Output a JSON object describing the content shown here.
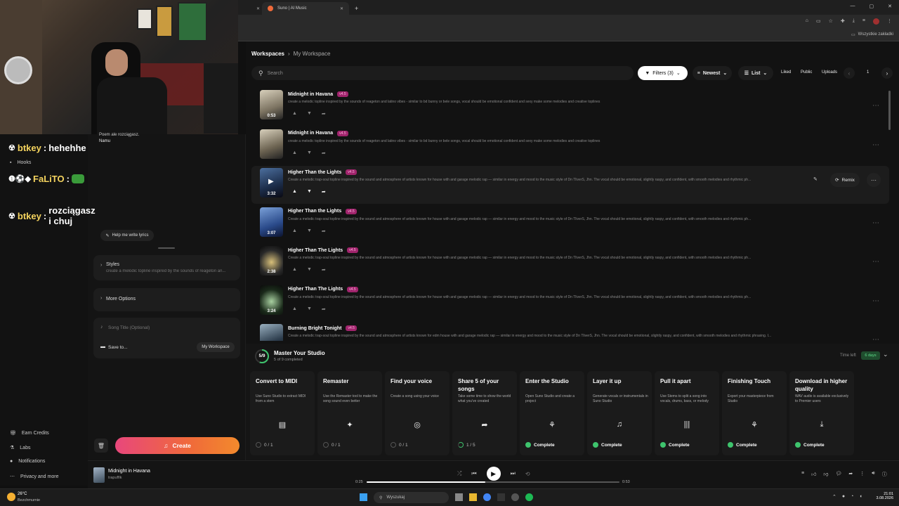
{
  "browser": {
    "tab_title": "Suno | AI Music",
    "bookmarks_label": "Wszystkie zakładki"
  },
  "chat_overlay": {
    "messages": [
      {
        "user": "btkey",
        "text": "hehehhe"
      },
      {
        "user": "FaLiTO",
        "text": ""
      },
      {
        "user": "btkey",
        "text": "rozciągasz i chuj"
      }
    ]
  },
  "create_panel": {
    "lyrics_partial": "Poem ale rozciągasz.",
    "lyrics_typed": "Namu",
    "hooks_label": "Hooks",
    "help_lyrics_label": "Help me write lyrics",
    "styles_label": "Styles",
    "styles_value": "create a melodic topline inspired by the sounds of reageton an...",
    "more_options_label": "More Options",
    "song_title_placeholder": "Song Title (Optional)",
    "save_to_label": "Save to...",
    "workspace_label": "My Workspace",
    "create_label": "Create"
  },
  "left_nav": {
    "items": [
      {
        "label": "Earn Credits",
        "icon": "gift-icon"
      },
      {
        "label": "Labs",
        "icon": "flask-icon"
      },
      {
        "label": "Notifications",
        "icon": "bell-icon"
      },
      {
        "label": "Privacy and more",
        "icon": "dots-icon"
      }
    ]
  },
  "breadcrumb": {
    "root": "Workspaces",
    "current": "My Workspace"
  },
  "toolbar": {
    "search_placeholder": "Search",
    "filters_label": "Filters (3)",
    "sort_label": "Newest",
    "view_label": "List",
    "liked": "Liked",
    "public": "Public",
    "uploads": "Uploads",
    "page": "1"
  },
  "songs": [
    {
      "title": "Midnight in Havana",
      "version": "v4.5",
      "duration": "0:53",
      "desc": "create a melodic topline inspired by the sounds of reageton and latino vibes - similar to bd bunny or bele songs, vocal should be emotional confident and sexy make some melodies and creative toplines"
    },
    {
      "title": "Midnight in Havana",
      "version": "v4.5",
      "duration": "",
      "desc": "create a melodic topline inspired by the sounds of reageton and latino vibes - similar to bd bunny or bele songs, vocal should be emotional confident and sexy make some melodies and creative toplines"
    },
    {
      "title": "Higher Than the Lights",
      "version": "v4.5",
      "duration": "3:32",
      "desc": "Create a melodic trap-soul topline inspired by the sound and atmosphere of artists known for house with and garage melodic rap — similar in energy and mood to the music style of Dn TliverS, Jhn. The vocal should be emotional, slightly raspy, and confident, with smooth melodies and rhythmic ph..."
    },
    {
      "title": "Higher Than the Lights",
      "version": "v4.5",
      "duration": "3:07",
      "desc": "Create a melodic trap-soul topline inspired by the sound and atmosphere of artists known for house with and garage melodic rap — similar in energy and mood to the music style of Dn TliverS, Jhn. The vocal should be emotional, slightly raspy, and confident, with smooth melodies and rhythmic ph..."
    },
    {
      "title": "Higher Than The Lights",
      "version": "v4.5",
      "duration": "2:38",
      "desc": "Create a melodic trap-soul topline inspired by the sound and atmosphere of artists known for house with and garage melodic rap — similar in energy and mood to the music style of Dn TliverS, Jhn. The vocal should be emotional, slightly raspy, and confident, with smooth melodies and rhythmic ph..."
    },
    {
      "title": "Higher Than The Lights",
      "version": "v4.5",
      "duration": "3:24",
      "desc": "Create a melodic trap-soul topline inspired by the sound and atmosphere of artists known for house with and garage melodic rap — similar in energy and mood to the music style of Dn TliverS, Jhn. The vocal should be emotional, slightly raspy, and confident, with smooth melodies and rhythmic ph..."
    },
    {
      "title": "Burning Bright Tonight",
      "version": "v4.5",
      "duration": "",
      "desc": "Create a melodic trap-soul topline inspired by the sound and atmosphere of artists known for edm house with and garage melodic rap — similar in energy and mood to the music style of Dn TliverS, Jhn. The vocal should be emotional, slightly raspy, and confident, with smooth melodies and rhythmic phrasing. I..."
    }
  ],
  "remix_label": "Remix",
  "studio": {
    "progress": "5/9",
    "progress_fraction": 0.5556,
    "title": "Master Your Studio",
    "subtitle": "5 of 9 completed",
    "time_left_label": "Time left",
    "time_left_value": "6 days",
    "tasks": [
      {
        "title": "Convert to MIDI",
        "desc": "Use Suno Studio to extract MIDI from a stem",
        "status": "0 / 1",
        "icon": "midi-icon"
      },
      {
        "title": "Remaster",
        "desc": "Use the Remaster tool to make the song sound even better",
        "status": "0 / 1",
        "icon": "wand-icon"
      },
      {
        "title": "Find your voice",
        "desc": "Create a song using your voice",
        "status": "0 / 1",
        "icon": "voice-icon"
      },
      {
        "title": "Share 5 of your songs",
        "desc": "Take some time to show the world what you've created",
        "status": "1 / 5",
        "icon": "share-icon"
      },
      {
        "title": "Enter the Studio",
        "desc": "Open Suno Studio and create a project",
        "status": "Complete",
        "icon": "studio-icon"
      },
      {
        "title": "Layer it up",
        "desc": "Generate vocals or instrumentals in Suno Studio",
        "status": "Complete",
        "icon": "music-note-icon"
      },
      {
        "title": "Pull it apart",
        "desc": "Use Stems to split a song into vocals, drums, bass, or melody",
        "status": "Complete",
        "icon": "waveform-icon"
      },
      {
        "title": "Finishing Touch",
        "desc": "Export your masterpiece from Studio",
        "status": "Complete",
        "icon": "export-icon"
      },
      {
        "title": "Download in higher quality",
        "desc": "WAV audio is available exclusively to Premier users",
        "status": "Complete",
        "icon": "download-icon"
      }
    ]
  },
  "player": {
    "title": "Midnight in Havana",
    "artist": "trapuffik",
    "current": "0:25",
    "total": "0:53",
    "progress": 0.47
  },
  "taskbar": {
    "weather_temp": "26°C",
    "weather_desc": "Bezchmurnie",
    "search_placeholder": "Wyszukaj",
    "time": "21:01",
    "date": "3.08.2026"
  }
}
